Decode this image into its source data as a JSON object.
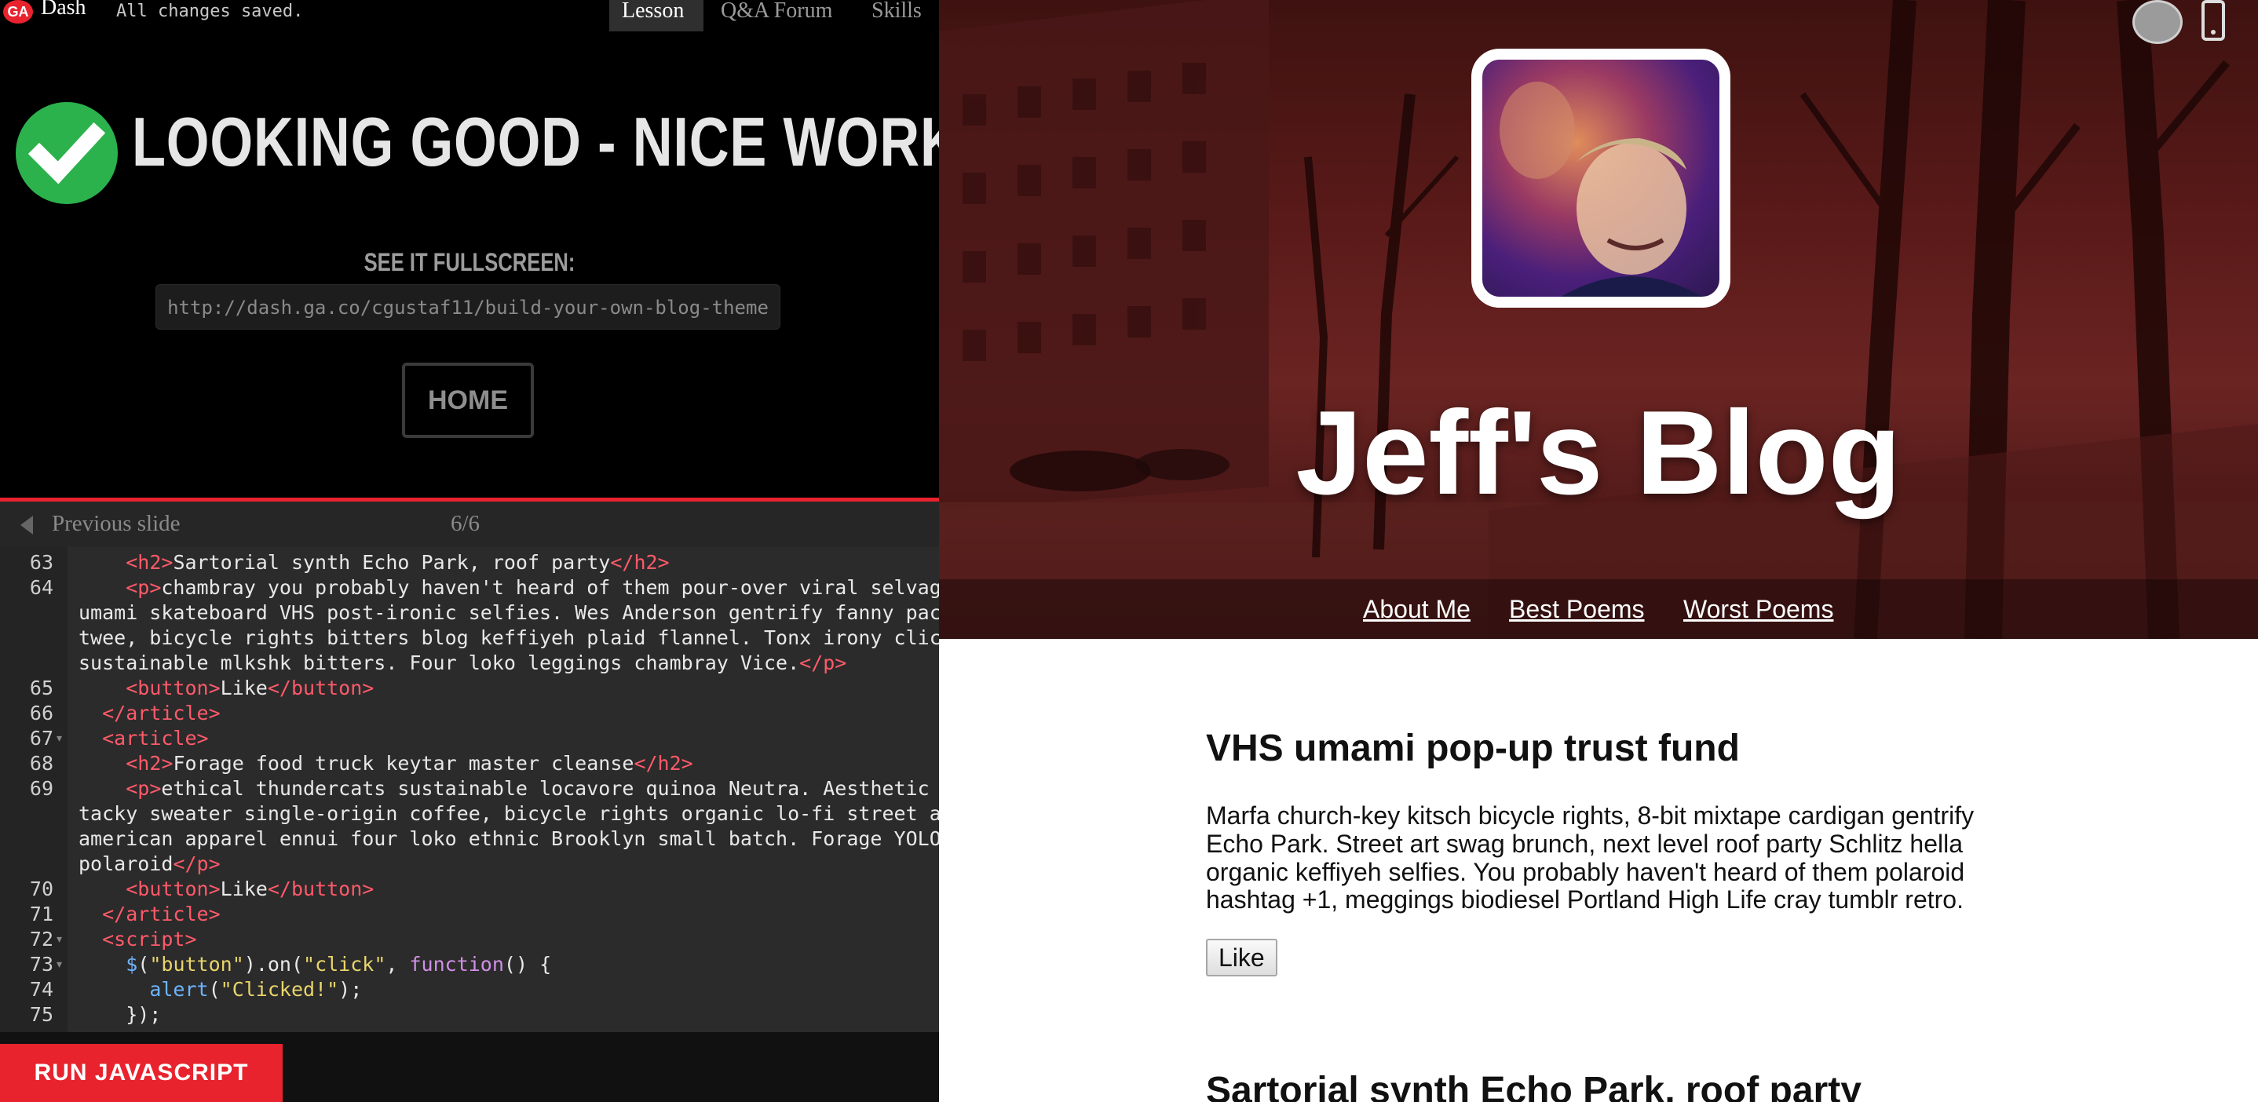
{
  "topbar": {
    "logo_text": "GA",
    "app_name": "Dash",
    "save_status": "All changes saved.",
    "tabs": [
      {
        "label": "Lesson",
        "active": true
      },
      {
        "label": "Q&A Forum",
        "active": false
      },
      {
        "label": "Skills",
        "active": false
      }
    ]
  },
  "success": {
    "message": "LOOKING GOOD - NICE WORK!",
    "fullscreen_label": "SEE IT FULLSCREEN:",
    "fullscreen_url": "http://dash.ga.co/cgustaf11/build-your-own-blog-theme",
    "home_label": "HOME",
    "check_color": "#2bb24c"
  },
  "slides": {
    "prev_label": "Previous slide",
    "counter": "6/6"
  },
  "editor": {
    "lines": [
      {
        "n": "63",
        "fold": false,
        "parts": [
          [
            "txt",
            "    "
          ],
          [
            "tag",
            "<h2>"
          ],
          [
            "txt",
            "Sartorial synth Echo Park, roof party"
          ],
          [
            "tag",
            "</h2>"
          ]
        ]
      },
      {
        "n": "64",
        "fold": false,
        "parts": [
          [
            "txt",
            "    "
          ],
          [
            "tag",
            "<p>"
          ],
          [
            "txt",
            "chambray you probably haven't heard of them pour-over viral selvage"
          ]
        ]
      },
      {
        "n": "",
        "fold": false,
        "parts": [
          [
            "txt",
            "umami skateboard VHS post-ironic selfies. Wes Anderson gentrify fanny pack"
          ]
        ]
      },
      {
        "n": "",
        "fold": false,
        "parts": [
          [
            "txt",
            "twee, bicycle rights bitters blog keffiyeh plaid flannel. Tonx irony cliche"
          ]
        ]
      },
      {
        "n": "",
        "fold": false,
        "parts": [
          [
            "txt",
            "sustainable mlkshk bitters. Four loko leggings chambray Vice."
          ],
          [
            "tag",
            "</p>"
          ]
        ]
      },
      {
        "n": "65",
        "fold": false,
        "parts": [
          [
            "txt",
            "    "
          ],
          [
            "tag",
            "<button>"
          ],
          [
            "txt",
            "Like"
          ],
          [
            "tag",
            "</button>"
          ]
        ]
      },
      {
        "n": "66",
        "fold": false,
        "parts": [
          [
            "txt",
            "  "
          ],
          [
            "tag",
            "</article>"
          ]
        ]
      },
      {
        "n": "67",
        "fold": true,
        "parts": [
          [
            "txt",
            "  "
          ],
          [
            "tag",
            "<article>"
          ]
        ]
      },
      {
        "n": "68",
        "fold": false,
        "parts": [
          [
            "txt",
            "    "
          ],
          [
            "tag",
            "<h2>"
          ],
          [
            "txt",
            "Forage food truck keytar master cleanse"
          ],
          [
            "tag",
            "</h2>"
          ]
        ]
      },
      {
        "n": "69",
        "fold": false,
        "parts": [
          [
            "txt",
            "    "
          ],
          [
            "tag",
            "<p>"
          ],
          [
            "txt",
            "ethical thundercats sustainable locavore quinoa Neutra. Aesthetic"
          ]
        ]
      },
      {
        "n": "",
        "fold": false,
        "parts": [
          [
            "txt",
            "tacky sweater single-origin coffee, bicycle rights organic lo-fi street art"
          ]
        ]
      },
      {
        "n": "",
        "fold": false,
        "parts": [
          [
            "txt",
            "american apparel ennui four loko ethnic Brooklyn small batch. Forage YOLO"
          ]
        ]
      },
      {
        "n": "",
        "fold": false,
        "parts": [
          [
            "txt",
            "polaroid"
          ],
          [
            "tag",
            "</p>"
          ]
        ]
      },
      {
        "n": "70",
        "fold": false,
        "parts": [
          [
            "txt",
            "    "
          ],
          [
            "tag",
            "<button>"
          ],
          [
            "txt",
            "Like"
          ],
          [
            "tag",
            "</button>"
          ]
        ]
      },
      {
        "n": "71",
        "fold": false,
        "parts": [
          [
            "txt",
            "  "
          ],
          [
            "tag",
            "</article>"
          ]
        ]
      },
      {
        "n": "72",
        "fold": true,
        "parts": [
          [
            "txt",
            "  "
          ],
          [
            "tag",
            "<script>"
          ]
        ]
      },
      {
        "n": "73",
        "fold": true,
        "parts": [
          [
            "txt",
            "    "
          ],
          [
            "dollar",
            "$"
          ],
          [
            "txt",
            "("
          ],
          [
            "str",
            "\"button\""
          ],
          [
            "txt",
            ").on("
          ],
          [
            "str",
            "\"click\""
          ],
          [
            "txt",
            ", "
          ],
          [
            "kw",
            "function"
          ],
          [
            "txt",
            "() {"
          ]
        ]
      },
      {
        "n": "74",
        "fold": false,
        "parts": [
          [
            "txt",
            "      "
          ],
          [
            "fn",
            "alert"
          ],
          [
            "txt",
            "("
          ],
          [
            "str",
            "\"Clicked!\""
          ],
          [
            "txt",
            ");"
          ]
        ]
      },
      {
        "n": "75",
        "fold": false,
        "parts": [
          [
            "txt",
            "    });"
          ]
        ]
      }
    ],
    "run_label": "RUN JAVASCRIPT"
  },
  "preview": {
    "blog_title": "Jeff's Blog",
    "nav": [
      "About Me",
      "Best Poems",
      "Worst Poems"
    ],
    "post1": {
      "title": "VHS umami pop-up trust fund",
      "body_lines": [
        "Marfa church-key kitsch bicycle rights, 8-bit mixtape cardigan gentrify",
        "Echo Park. Street art swag brunch, next level roof party Schlitz hella",
        "organic keffiyeh selfies. You probably haven't heard of them polaroid",
        "hashtag +1, meggings biodiesel Portland High Life cray tumblr retro."
      ],
      "like_label": "Like"
    },
    "post2": {
      "title": "Sartorial synth Echo Park, roof party"
    }
  }
}
